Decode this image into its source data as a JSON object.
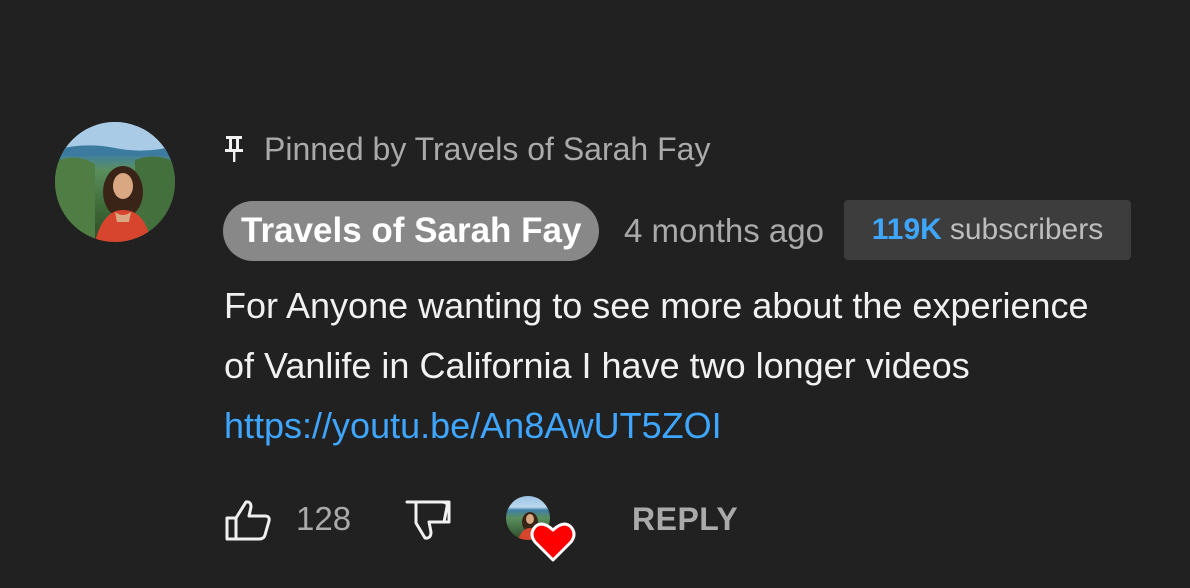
{
  "pinned": {
    "text": "Pinned by Travels of Sarah Fay",
    "icon": "pin-icon"
  },
  "comment": {
    "author": "Travels of Sarah Fay",
    "timestamp": "4 months ago",
    "subscribers_tooltip": {
      "count": "119K",
      "label": "subscribers"
    },
    "text": "For Anyone wanting to see more about the experience of Vanlife in California I have two longer videos",
    "link": "https://youtu.be/An8AwUT5ZOI"
  },
  "actions": {
    "like_icon": "thumbs-up-icon",
    "like_count": "128",
    "dislike_icon": "thumbs-down-icon",
    "creator_heart_icon": "heart-icon",
    "reply_label": "REPLY"
  },
  "colors": {
    "background": "#212121",
    "link": "#3ea6ff",
    "author_chip": "#888888",
    "heart": "#ff0000",
    "muted_text": "#aaaaaa"
  }
}
